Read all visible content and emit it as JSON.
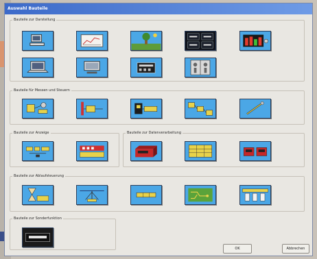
{
  "window": {
    "title": "Auswahl Bauteile"
  },
  "groups": [
    {
      "id": "steuerung",
      "label": "Bauteile zur Darstellung"
    },
    {
      "id": "messen",
      "label": "Bauteile für Messen und Steuern"
    },
    {
      "id": "anzeigen",
      "label": "Bauteile zur Anzeige"
    },
    {
      "id": "datenverarbeitung",
      "label": "Bauteile zur Datenverarbeitung"
    },
    {
      "id": "ablaufsteuerung",
      "label": "Bauteile zur Ablaufsteuerung"
    },
    {
      "id": "sonderfunktionen",
      "label": "Bauteile zur Sonderfunktion"
    }
  ],
  "icons": [
    "computer-icon",
    "chart-window-icon",
    "landscape-icon",
    "numeric-display-icon",
    "bar-meter-icon",
    "laptop-icon",
    "monitor-icon",
    "keypad-panel-icon",
    "switch-panel-icon",
    "sensor-icon",
    "relay-icon",
    "terminal-icon",
    "network-icon",
    "probe-icon",
    "converter-icon",
    "counter-icon",
    "storage-block-icon",
    "data-table-icon",
    "register-icon",
    "hourglass-icon",
    "antenna-icon",
    "timer-bar-icon",
    "circuit-icon",
    "connector-panel-icon",
    "display-text-icon"
  ],
  "buttons": {
    "ok": "OK",
    "cancel": "Abbrechen"
  },
  "colors": {
    "tile": "#4ba7e6",
    "title_bar": "#3c6ac9",
    "window_bg": "#e9e7e2"
  }
}
